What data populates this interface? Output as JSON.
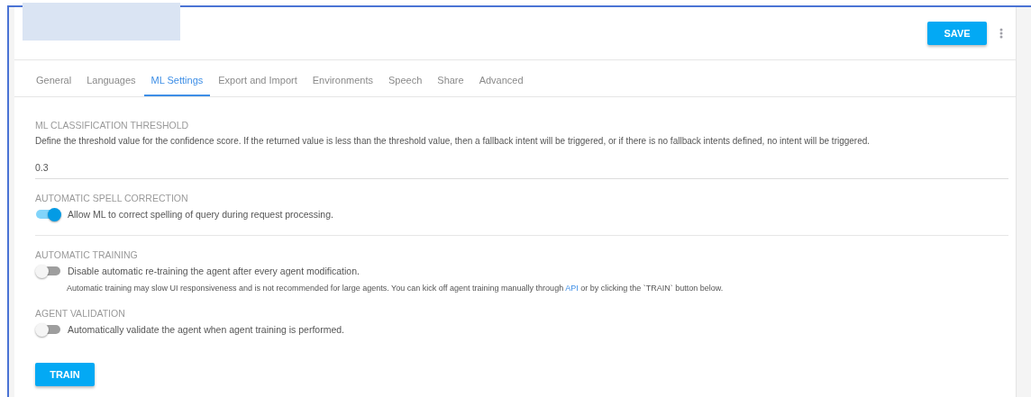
{
  "header": {
    "save_label": "SAVE"
  },
  "tabs": [
    {
      "label": "General",
      "selected": false
    },
    {
      "label": "Languages",
      "selected": false
    },
    {
      "label": "ML Settings",
      "selected": true
    },
    {
      "label": "Export and Import",
      "selected": false
    },
    {
      "label": "Environments",
      "selected": false
    },
    {
      "label": "Speech",
      "selected": false
    },
    {
      "label": "Share",
      "selected": false
    },
    {
      "label": "Advanced",
      "selected": false
    }
  ],
  "sections": [
    {
      "kind": "field",
      "heading": "ML CLASSIFICATION THRESHOLD",
      "description": "Define the threshold value for the confidence score. If the returned value is less than the threshold value, then a fallback intent will be triggered, or if there is no fallback intents defined, no intent will be triggered.",
      "value": "0.3"
    },
    {
      "kind": "toggle",
      "heading": "AUTOMATIC SPELL CORRECTION",
      "label": "Allow ML to correct spelling of query during request processing.",
      "on": true,
      "divider": true
    },
    {
      "kind": "toggle",
      "heading": "AUTOMATIC TRAINING",
      "label": "Disable automatic re-training the agent after every agent modification.",
      "on": false,
      "note": {
        "before": "Automatic training may slow UI responsiveness and is not recommended for large agents. You can kick off agent training manually through",
        "link": "API",
        "after": "or by clicking the `TRAIN` button below."
      }
    },
    {
      "kind": "toggle",
      "heading": "AGENT VALIDATION",
      "label": "Automatically validate the agent when agent training is performed.",
      "on": false
    }
  ],
  "train_label": "TRAIN"
}
